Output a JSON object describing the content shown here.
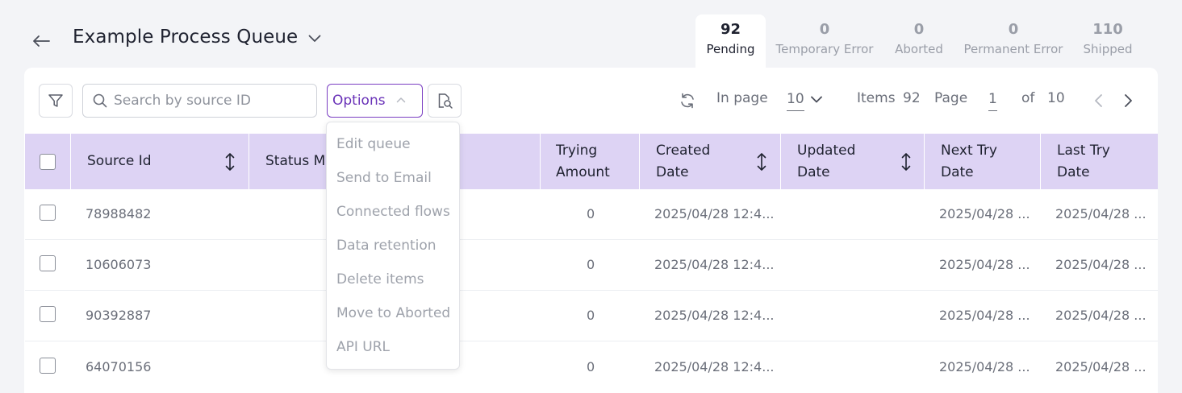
{
  "header": {
    "title": "Example Process Queue",
    "back_icon": "arrow-left-icon",
    "title_dropdown_icon": "chevron-down-icon"
  },
  "stats": [
    {
      "count": "92",
      "label": "Pending",
      "active": true
    },
    {
      "count": "0",
      "label": "Temporary Error",
      "active": false
    },
    {
      "count": "0",
      "label": "Aborted",
      "active": false
    },
    {
      "count": "0",
      "label": "Permanent Error",
      "active": false
    },
    {
      "count": "110",
      "label": "Shipped",
      "active": false
    }
  ],
  "toolbar": {
    "search_placeholder": "Search by source ID",
    "options_label": "Options"
  },
  "pager": {
    "in_page_label": "In page",
    "in_page_value": "10",
    "items_label": "Items",
    "items_value": "92",
    "page_label": "Page",
    "page_value": "1",
    "of_label": "of",
    "of_value": "10"
  },
  "table": {
    "columns": [
      {
        "line1": "Source Id",
        "line2": ""
      },
      {
        "line1": "Status Me",
        "line2": ""
      },
      {
        "line1": "Trying",
        "line2": "Amount"
      },
      {
        "line1": "Created",
        "line2": "Date"
      },
      {
        "line1": "Updated",
        "line2": "Date"
      },
      {
        "line1": "Next Try",
        "line2": "Date"
      },
      {
        "line1": "Last Try",
        "line2": "Date"
      }
    ],
    "rows": [
      {
        "source_id": "78988482",
        "trying": "0",
        "created": "2025/04/28 12:4...",
        "next_try": "2025/04/28 ...",
        "last_try": "2025/04/28 ..."
      },
      {
        "source_id": "10606073",
        "trying": "0",
        "created": "2025/04/28 12:4...",
        "next_try": "2025/04/28 ...",
        "last_try": "2025/04/28 ..."
      },
      {
        "source_id": "90392887",
        "trying": "0",
        "created": "2025/04/28 12:4...",
        "next_try": "2025/04/28 ...",
        "last_try": "2025/04/28 ..."
      },
      {
        "source_id": "64070156",
        "trying": "0",
        "created": "2025/04/28 12:4...",
        "next_try": "2025/04/28 ...",
        "last_try": "2025/04/28 ..."
      }
    ]
  },
  "options_menu": [
    "Edit queue",
    "Send to Email",
    "Connected flows",
    "Data retention",
    "Delete items",
    "Move to Aborted",
    "API URL"
  ],
  "colors": {
    "accent": "#6a33b8",
    "header_bg": "#ddd3f4",
    "page_bg": "#f3f4f7"
  }
}
